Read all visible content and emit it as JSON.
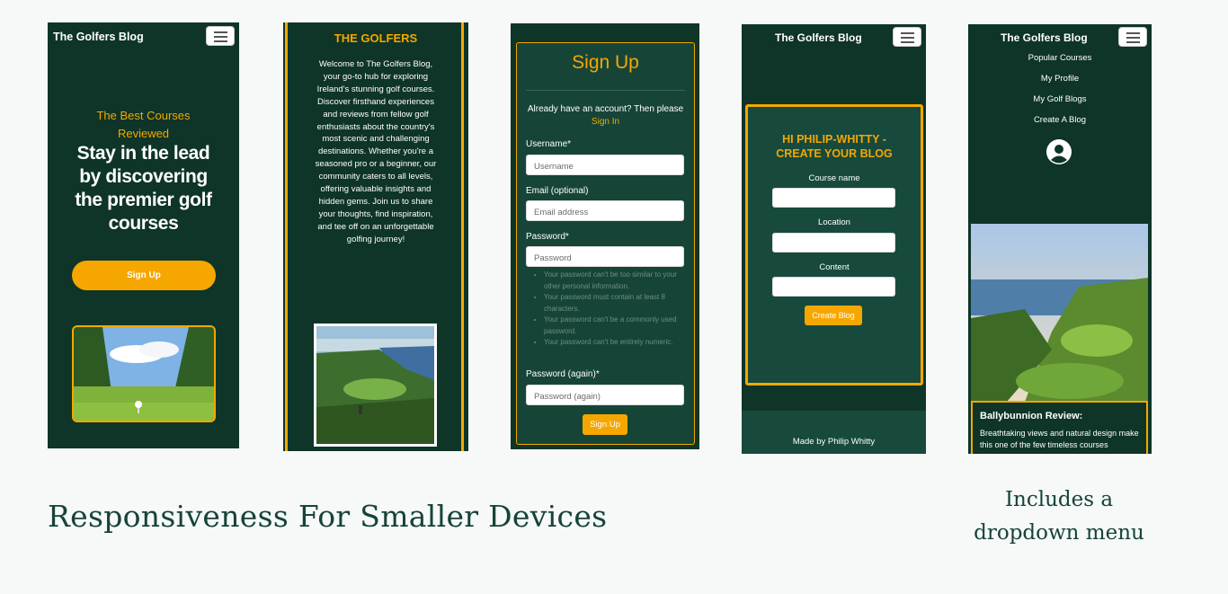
{
  "colors": {
    "dark_green": "#0e3527",
    "mid_green": "#1a4a40",
    "accent": "#f5a700",
    "bg": "#f6f9f8"
  },
  "screen1": {
    "brand": "The Golfers Blog",
    "tagline1": "The Best Courses",
    "tagline2": "Reviewed",
    "headline": "Stay in the lead by discovering the premier golf courses",
    "button": "Sign Up"
  },
  "screen2": {
    "title": "THE GOLFERS",
    "paragraph": "Welcome to The Golfers Blog, your go-to hub for exploring Ireland's stunning golf courses. Discover firsthand experiences and reviews from fellow golf enthusiasts about the country's most scenic and challenging destinations. Whether you're a seasoned pro or a beginner, our community caters to all levels, offering valuable insights and hidden gems. Join us to share your thoughts, find inspiration, and tee off on an unforgettable golfing journey!"
  },
  "screen3": {
    "title": "Sign Up",
    "already": "Already have an account? Then please",
    "signin_link": "Sign In",
    "username_label": "Username*",
    "username_placeholder": "Username",
    "email_label": "Email (optional)",
    "email_placeholder": "Email address",
    "password_label": "Password*",
    "password_placeholder": "Password",
    "hints": [
      "Your password can't be too similar to your other personal information.",
      "Your password must contain at least 8 characters.",
      "Your password can't be a commonly used password.",
      "Your password can't be entirely numeric."
    ],
    "password2_label": "Password (again)*",
    "password2_placeholder": "Password (again)",
    "button": "Sign Up"
  },
  "screen4": {
    "brand": "The Golfers Blog",
    "heading": "HI PHILIP-WHITTY - CREATE YOUR BLOG",
    "course_label": "Course name",
    "location_label": "Location",
    "content_label": "Content",
    "button": "Create Blog",
    "footer": "Made by Philip Whitty"
  },
  "screen5": {
    "brand": "The Golfers Blog",
    "menu": [
      "Popular Courses",
      "My Profile",
      "My Golf Blogs",
      "Create A Blog"
    ],
    "card_title": "Ballybunnion Review:",
    "card_text": "Breathtaking views and natural design make this one of the few timeless courses"
  },
  "captions": {
    "main": "Responsiveness For Smaller Devices",
    "side": "Includes a dropdown menu"
  }
}
